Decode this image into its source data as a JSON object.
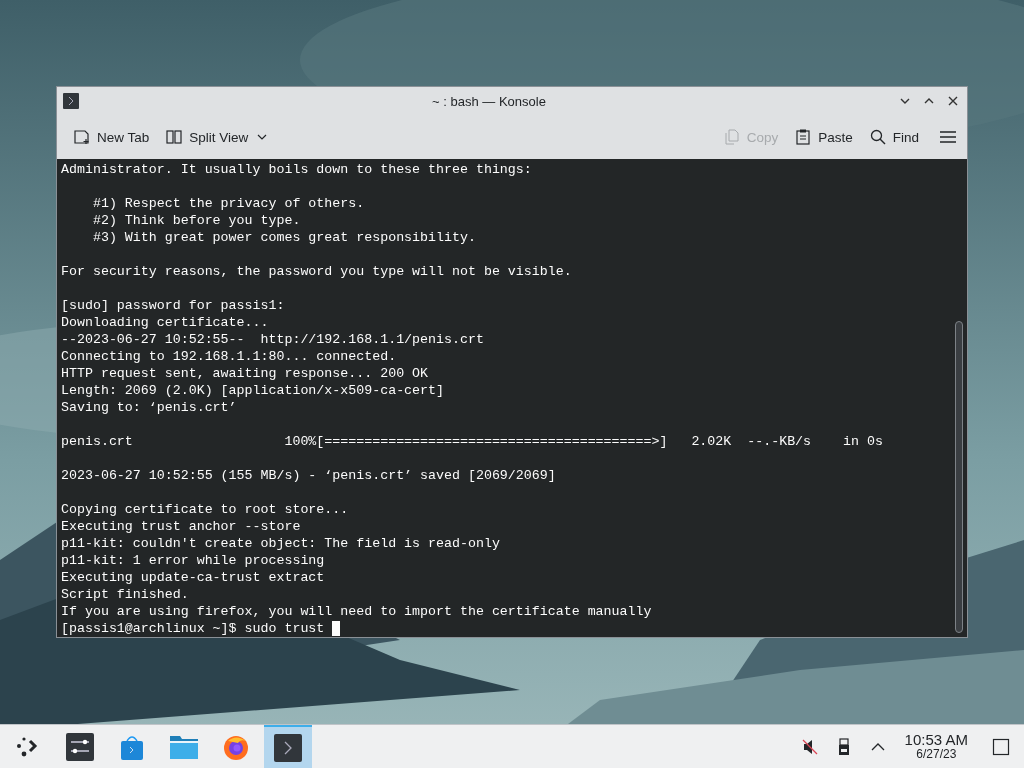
{
  "window": {
    "title": "~ : bash — Konsole"
  },
  "toolbar": {
    "left": [
      {
        "kind": "new-tab",
        "label": "New Tab",
        "disabled": false,
        "dropdown": false
      },
      {
        "kind": "split-view",
        "label": "Split View",
        "disabled": false,
        "dropdown": true
      }
    ],
    "right": [
      {
        "kind": "copy",
        "label": "Copy",
        "disabled": true,
        "dropdown": false
      },
      {
        "kind": "paste",
        "label": "Paste",
        "disabled": false,
        "dropdown": false
      },
      {
        "kind": "find",
        "label": "Find",
        "disabled": false,
        "dropdown": false
      }
    ]
  },
  "terminal": {
    "blocks": [
      [
        "Administrator. It usually boils down to these three things:"
      ],
      [
        "    #1) Respect the privacy of others.",
        "    #2) Think before you type.",
        "    #3) With great power comes great responsibility."
      ],
      [
        "For security reasons, the password you type will not be visible."
      ],
      [
        "[sudo] password for passis1:",
        "Downloading certificate...",
        "--2023-06-27 10:52:55--  http://192.168.1.1/penis.crt",
        "Connecting to 192.168.1.1:80... connected.",
        "HTTP request sent, awaiting response... 200 OK",
        "Length: 2069 (2.0K) [application/x-x509-ca-cert]",
        "Saving to: ‘penis.crt’"
      ],
      [
        "penis.crt                   100%[=========================================>]   2.02K  --.-KB/s    in 0s"
      ],
      [
        "2023-06-27 10:52:55 (155 MB/s) - ‘penis.crt’ saved [2069/2069]"
      ],
      [
        "Copying certificate to root store...",
        "Executing trust anchor --store",
        "p11-kit: couldn't create object: The field is read-only",
        "p11-kit: 1 error while processing",
        "Executing update-ca-trust extract",
        "Script finished.",
        "If you are using firefox, you will need to import the certificate manually"
      ]
    ],
    "prompt": "[passis1@archlinux ~]$ sudo trust"
  },
  "taskbar": {
    "tasks": [
      {
        "kind": "launcher",
        "selected": false
      },
      {
        "kind": "settings",
        "selected": false
      },
      {
        "kind": "store",
        "selected": false
      },
      {
        "kind": "files",
        "selected": false
      },
      {
        "kind": "browser",
        "selected": false
      },
      {
        "kind": "terminal",
        "selected": true
      }
    ],
    "tray": {
      "time": "10:53 AM",
      "date": "6/27/23"
    }
  }
}
